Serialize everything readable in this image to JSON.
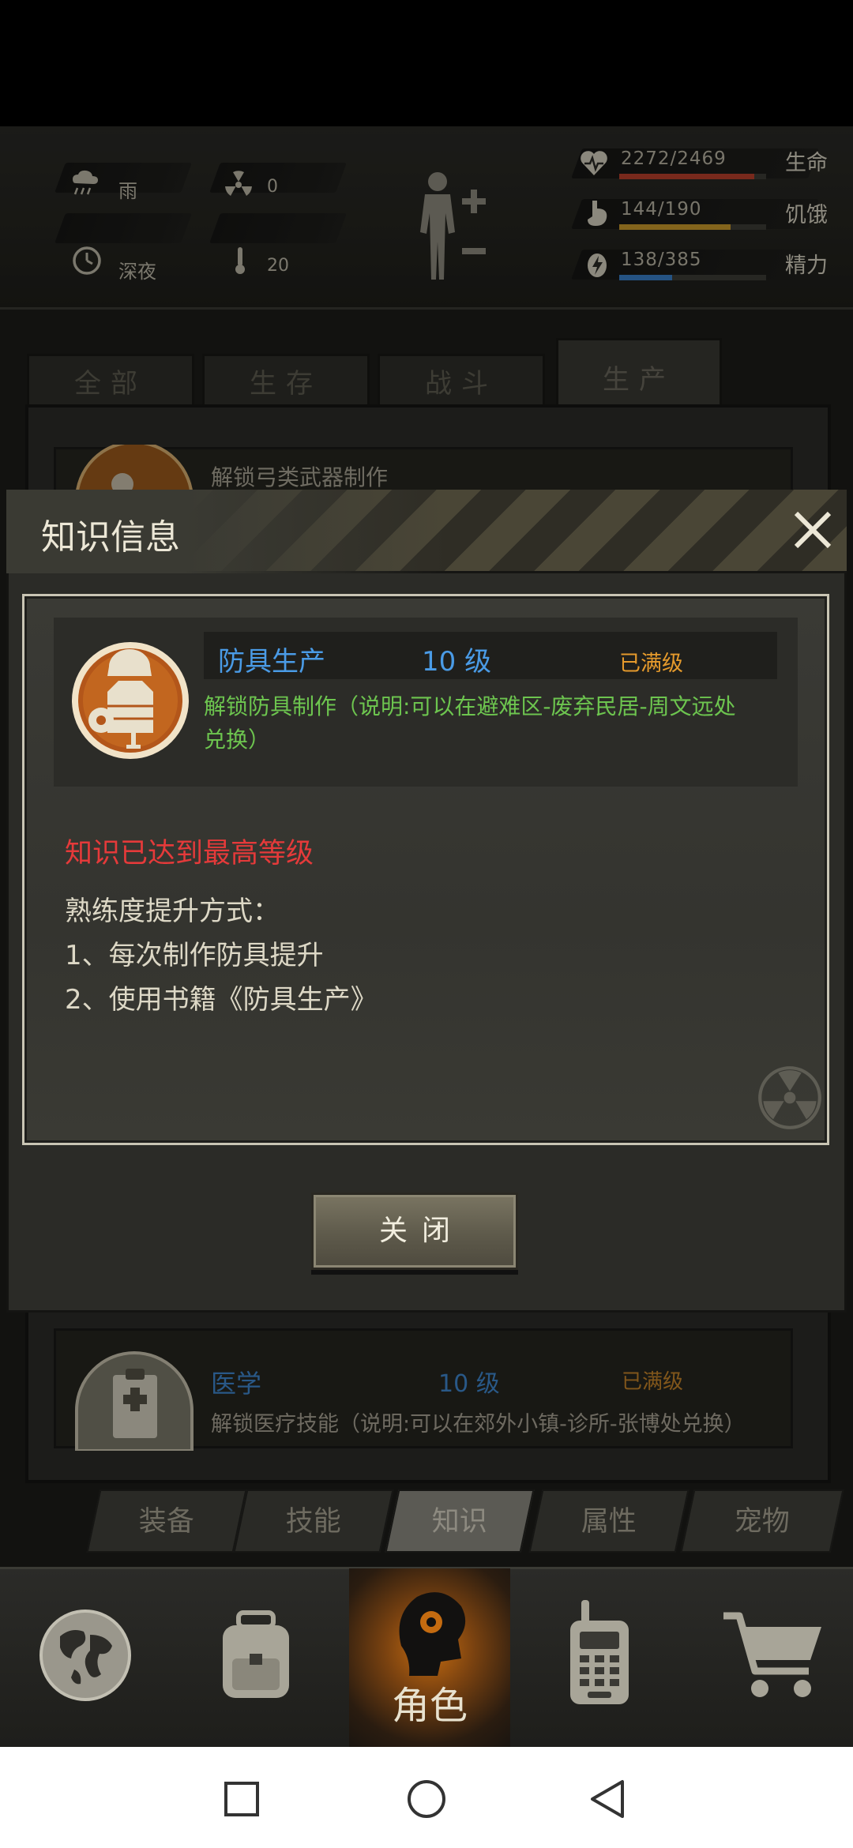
{
  "hud": {
    "weather": "雨",
    "radiation": "0",
    "time_of_day": "深夜",
    "temperature": "20",
    "health": {
      "label": "生命",
      "value": "2272/2469",
      "fraction": 0.92,
      "color": "#b9402c"
    },
    "hunger": {
      "label": "饥饿",
      "value": "144/190",
      "fraction": 0.76,
      "color": "#c99a2c"
    },
    "energy": {
      "label": "精力",
      "value": "138/385",
      "fraction": 0.36,
      "color": "#3a80c9"
    }
  },
  "tabs": [
    {
      "label": "全部"
    },
    {
      "label": "生存"
    },
    {
      "label": "战斗"
    },
    {
      "label": "生产"
    }
  ],
  "list": {
    "top_item_desc": "解锁弓类武器制作",
    "bottom_item": {
      "name": "医学",
      "level": "10 级",
      "status": "已满级",
      "desc": "解锁医疗技能（说明:可以在郊外小镇-诊所-张博处兑换）"
    }
  },
  "modal": {
    "title": "知识信息",
    "skill_name": "防具生产",
    "skill_level": "10 级",
    "skill_status": "已满级",
    "skill_desc": "解锁防具制作（说明:可以在避难区-废弃民居-周文远处兑换）",
    "max_note": "知识已达到最高等级",
    "method_title": "熟练度提升方式：",
    "methods": [
      "1、每次制作防具提升",
      "2、使用书籍《防具生产》"
    ],
    "close_button": "关闭"
  },
  "subtabs": [
    {
      "label": "装备"
    },
    {
      "label": "技能"
    },
    {
      "label": "知识"
    },
    {
      "label": "属性"
    },
    {
      "label": "宠物"
    }
  ],
  "nav": {
    "role_label": "角色",
    "items": [
      "world-map-icon",
      "backpack-icon",
      "character-icon",
      "radio-icon",
      "shop-cart-icon"
    ]
  }
}
